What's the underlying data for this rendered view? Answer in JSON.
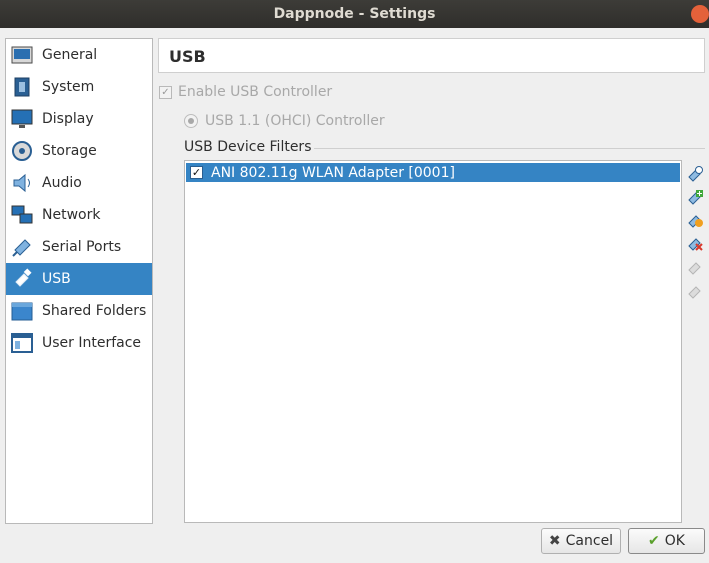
{
  "window": {
    "title": "Dappnode - Settings"
  },
  "sidebar": {
    "items": [
      {
        "label": "General",
        "icon": "general-icon",
        "active": false
      },
      {
        "label": "System",
        "icon": "system-chip-icon",
        "active": false
      },
      {
        "label": "Display",
        "icon": "display-monitor-icon",
        "active": false
      },
      {
        "label": "Storage",
        "icon": "storage-disk-icon",
        "active": false
      },
      {
        "label": "Audio",
        "icon": "audio-speaker-icon",
        "active": false
      },
      {
        "label": "Network",
        "icon": "network-icon",
        "active": false
      },
      {
        "label": "Serial Ports",
        "icon": "serial-port-icon",
        "active": false
      },
      {
        "label": "USB",
        "icon": "usb-icon",
        "active": true
      },
      {
        "label": "Shared Folders",
        "icon": "shared-folder-icon",
        "active": false
      },
      {
        "label": "User Interface",
        "icon": "user-interface-icon",
        "active": false
      }
    ]
  },
  "page": {
    "title": "USB",
    "enable_controller": {
      "label": "Enable USB Controller",
      "checked": true,
      "enabled": false
    },
    "controller_option": {
      "label": "USB 1.1 (OHCI) Controller",
      "selected": true,
      "enabled": false
    },
    "filters": {
      "title": "USB Device Filters",
      "items": [
        {
          "label": "ANI 802.11g WLAN Adapter [0001]",
          "checked": true,
          "selected": true
        }
      ]
    }
  },
  "toolbar": {
    "buttons": [
      {
        "name": "add-empty-filter-icon",
        "enabled": true
      },
      {
        "name": "add-filter-from-device-icon",
        "enabled": true
      },
      {
        "name": "edit-filter-icon",
        "enabled": true
      },
      {
        "name": "remove-filter-icon",
        "enabled": true
      },
      {
        "name": "move-filter-up-icon",
        "enabled": false
      },
      {
        "name": "move-filter-down-icon",
        "enabled": false
      }
    ]
  },
  "buttons": {
    "cancel_label": "Cancel",
    "ok_label": "OK"
  },
  "colors": {
    "selection": "#3584c4",
    "titlebar": "#3d3c38",
    "close": "#e4613a"
  }
}
